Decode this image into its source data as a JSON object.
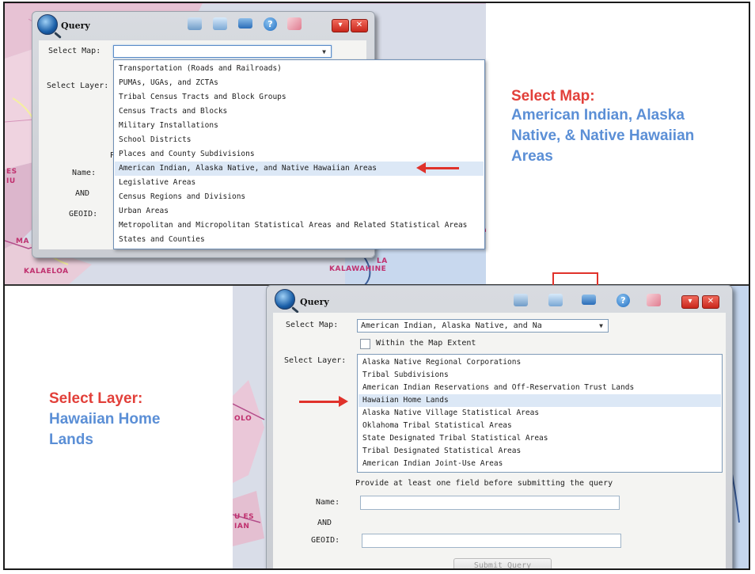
{
  "colors": {
    "caption_red": "#e2403a",
    "caption_blue": "#5b8fd6",
    "arrow": "#e0322b"
  },
  "map_labels": [
    "ES",
    "IU",
    "MA",
    "KALAELOA",
    "NA",
    "LA",
    "KALAWAHINE",
    "OLO",
    "U ES",
    "IAN"
  ],
  "top_dialog": {
    "title": "Query",
    "select_map_label": "Select Map:",
    "select_layer_label": "Select Layer:",
    "partial_label": "P",
    "name_label": "Name:",
    "and_label": "AND",
    "geoid_label": "GEOID:",
    "select_map_value": "",
    "map_options": [
      "Transportation (Roads and Railroads)",
      "PUMAs, UGAs, and ZCTAs",
      "Tribal Census Tracts and Block Groups",
      "Census Tracts and Blocks",
      "Military Installations",
      "School Districts",
      "Places and County Subdivisions",
      "American Indian, Alaska Native, and Native Hawaiian Areas",
      "Legislative Areas",
      "Census Regions and Divisions",
      "Urban Areas",
      "Metropolitan and Micropolitan Statistical Areas and Related Statistical Areas",
      "States and Counties"
    ],
    "highlighted_option": "American Indian, Alaska Native, and Native Hawaiian Areas",
    "toolbar_icons": [
      "map-tool-icon",
      "add-layer-icon",
      "layer-list-icon",
      "help-icon",
      "broom-icon",
      "minimize-icon",
      "close-icon"
    ]
  },
  "bottom_dialog": {
    "title": "Query",
    "select_map_label": "Select Map:",
    "select_map_value": "American Indian, Alaska Native, and Na",
    "within_extent_label": "Within the Map Extent",
    "within_extent_checked": false,
    "select_layer_label": "Select Layer:",
    "layer_options": [
      "Alaska Native Regional Corporations",
      "Tribal Subdivisions",
      "American Indian Reservations and Off-Reservation Trust Lands",
      "Hawaiian Home Lands",
      "Alaska Native Village Statistical Areas",
      "Oklahoma Tribal Statistical Areas",
      "State Designated Tribal Statistical Areas",
      "Tribal Designated Statistical Areas",
      "American Indian Joint-Use Areas"
    ],
    "selected_layer": "Hawaiian Home Lands",
    "hint": "Provide at least one field before submitting the query",
    "name_label": "Name:",
    "and_label": "AND",
    "geoid_label": "GEOID:",
    "name_value": "",
    "geoid_value": "",
    "submit_label": "Submit Query"
  },
  "captions": {
    "map_title": "Select Map:",
    "map_value_lines": [
      "American Indian, Alaska",
      "Native, & Native Hawaiian",
      "Areas"
    ],
    "layer_title": "Select Layer:",
    "layer_value_lines": [
      "Hawaiian Home",
      "Lands"
    ]
  }
}
